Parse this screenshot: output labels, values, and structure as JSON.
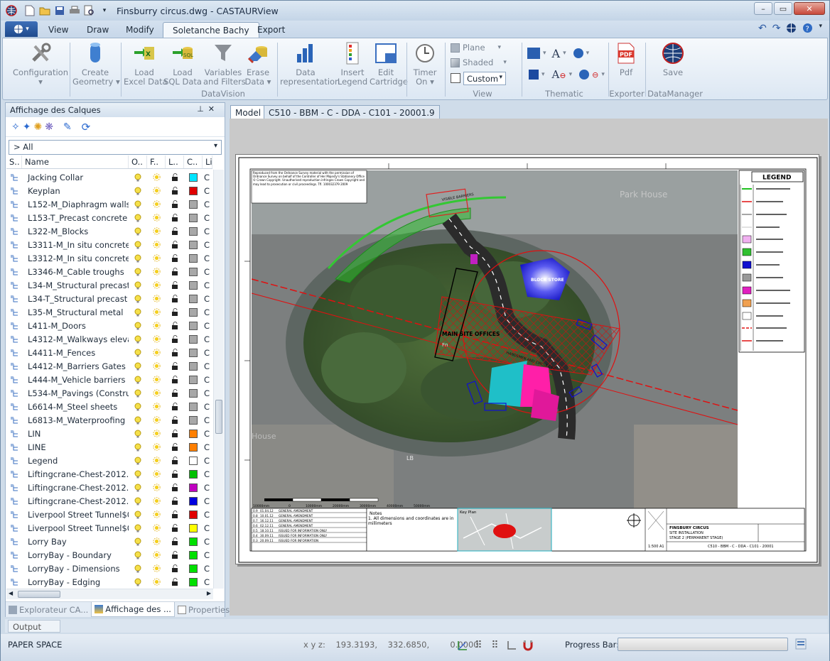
{
  "title": {
    "text": "Finsburry circus.dwg - CASTAURView"
  },
  "qat": {
    "icons": [
      "new-file-icon",
      "open-folder-icon",
      "save-icon",
      "print-icon",
      "print-preview-icon",
      "qat-dropdown-icon"
    ]
  },
  "ribbon_tabs": [
    {
      "label": "View",
      "active": false
    },
    {
      "label": "Draw",
      "active": false
    },
    {
      "label": "Modify",
      "active": false
    },
    {
      "label": "Soletanche Bachy",
      "active": true
    },
    {
      "label": "Export",
      "active": false
    }
  ],
  "ribbon": {
    "buttons": [
      {
        "id": "configuration",
        "label1": "Configuration",
        "label2": "▾",
        "icon": "tools-icon"
      },
      {
        "id": "create_geometry",
        "label1": "Create",
        "label2": "Geometry ▾",
        "icon": "cylinder-icon"
      },
      {
        "id": "load_excel",
        "label1": "Load",
        "label2": "Excel Data",
        "icon": "excel-load-icon"
      },
      {
        "id": "load_sql",
        "label1": "Load",
        "label2": "SQL Data",
        "icon": "sql-load-icon"
      },
      {
        "id": "variables_filters",
        "label1": "Variables",
        "label2": "and Filters",
        "icon": "funnel-icon"
      },
      {
        "id": "erase_data",
        "label1": "Erase",
        "label2": "Data ▾",
        "icon": "eraser-icon"
      },
      {
        "id": "data_representation",
        "label1": "Data",
        "label2": "representation",
        "icon": "bar-chart-icon"
      },
      {
        "id": "insert_legend",
        "label1": "Insert",
        "label2": "Legend",
        "icon": "legend-icon"
      },
      {
        "id": "edit_cartridge",
        "label1": "Edit",
        "label2": "Cartridge",
        "icon": "cartridge-icon"
      },
      {
        "id": "timer_on",
        "label1": "Timer",
        "label2": "On ▾",
        "icon": "clock-icon"
      },
      {
        "id": "pdf",
        "label1": "Pdf",
        "label2": "",
        "icon": "pdf-icon"
      },
      {
        "id": "save",
        "label1": "Save",
        "label2": "",
        "icon": "globe-save-icon"
      }
    ],
    "view_small": {
      "plane": "Plane",
      "shaded": "Shaded",
      "custom": "Custom"
    },
    "groups": {
      "datavision": "DataVision",
      "view": "View",
      "thematic": "Thematic",
      "exporter": "Exporter",
      "datamanager": "DataManager"
    }
  },
  "left_panel": {
    "title": "Affichage des Calques",
    "filter": "> All",
    "columns": [
      "S..",
      "Name",
      "O..",
      "F..",
      "L..",
      "C..",
      "Li"
    ],
    "layers": [
      {
        "name": "Jacking Collar",
        "color": "#00e5ff",
        "lt": "C"
      },
      {
        "name": "Keyplan",
        "color": "#e00000",
        "lt": "C"
      },
      {
        "name": "L152-M_Diaphragm walls an",
        "color": "#a8a8a8",
        "lt": "C"
      },
      {
        "name": "L153-T_Precast concrete ret",
        "color": "#a8a8a8",
        "lt": "C"
      },
      {
        "name": "L322-M_Blocks",
        "color": "#a8a8a8",
        "lt": "C"
      },
      {
        "name": "L3311-M_In situ concrete M",
        "color": "#a8a8a8",
        "lt": "C"
      },
      {
        "name": "L3312-M_In situ concrete Re",
        "color": "#a8a8a8",
        "lt": "C"
      },
      {
        "name": "L3346-M_Cable troughs",
        "color": "#a8a8a8",
        "lt": "C"
      },
      {
        "name": "L34-M_Structural precast co",
        "color": "#a8a8a8",
        "lt": "C"
      },
      {
        "name": "L34-T_Structural precast co",
        "color": "#a8a8a8",
        "lt": "C"
      },
      {
        "name": "L35-M_Structural metal",
        "color": "#a8a8a8",
        "lt": "C"
      },
      {
        "name": "L411-M_Doors",
        "color": "#a8a8a8",
        "lt": "C"
      },
      {
        "name": "L4312-M_Walkways elevate",
        "color": "#a8a8a8",
        "lt": "C"
      },
      {
        "name": "L4411-M_Fences",
        "color": "#a8a8a8",
        "lt": "C"
      },
      {
        "name": "L4412-M_Barriers Gates",
        "color": "#a8a8a8",
        "lt": "C"
      },
      {
        "name": "L444-M_Vehicle barriers",
        "color": "#a8a8a8",
        "lt": "C"
      },
      {
        "name": "L534-M_Pavings (Construct",
        "color": "#a8a8a8",
        "lt": "C"
      },
      {
        "name": "L6614-M_Steel sheets",
        "color": "#a8a8a8",
        "lt": "C"
      },
      {
        "name": "L6813-M_Waterproofing",
        "color": "#a8a8a8",
        "lt": "C"
      },
      {
        "name": "LIN",
        "color": "#ff7f00",
        "lt": "C"
      },
      {
        "name": "LINE",
        "color": "#ff7f00",
        "lt": "C"
      },
      {
        "name": "Legend",
        "color": "#ffffff",
        "lt": "C"
      },
      {
        "name": "Liftingcrane-Chest-2012.01.",
        "color": "#00c000",
        "lt": "C"
      },
      {
        "name": "Liftingcrane-Chest-2012.03.",
        "color": "#c000c0",
        "lt": "C"
      },
      {
        "name": "Liftingcrane-Chest-2012.03.",
        "color": "#0000e0",
        "lt": "C"
      },
      {
        "name": "Liverpool Street Tunnel$0$E",
        "color": "#e00000",
        "lt": "C"
      },
      {
        "name": "Liverpool Street Tunnel$0$I",
        "color": "#ffff00",
        "lt": "C"
      },
      {
        "name": "Lorry Bay",
        "color": "#00e000",
        "lt": "C"
      },
      {
        "name": "LorryBay - Boundary",
        "color": "#00e000",
        "lt": "C"
      },
      {
        "name": "LorryBay - Dimensions",
        "color": "#00e000",
        "lt": "C"
      },
      {
        "name": "LorryBay - Edging",
        "color": "#00e000",
        "lt": "C"
      }
    ],
    "bottom_tabs": [
      {
        "label": "Explorateur CA...",
        "active": false,
        "icon": "explorer-icon"
      },
      {
        "label": "Affichage des ...",
        "active": true,
        "icon": "layers-icon"
      },
      {
        "label": "Properties",
        "active": false,
        "icon": "properties-icon"
      }
    ]
  },
  "doc_tabs": {
    "model": "Model",
    "layout": "C510 - BBM - C - DDA - C101 - 20001.9"
  },
  "drawing": {
    "legend_title": "LEGEND",
    "labels": {
      "main_site_offices": "MAIN SITE OFFICES",
      "block_store": "BLOCK STORE",
      "notes_title": "Notes",
      "note_1": "1. All dimensions and coordinates are in millimeters",
      "keyplan": "Key Plan",
      "project_title": "FINSBURY CIRCUS",
      "project_sub1": "SITE INSTALLATION",
      "project_sub2": "STAGE 2 (PERMANENT STAGE)",
      "doc_number": "C510 - BBM - C - DDA - C101 - 20001",
      "scale": "1:500",
      "paper": "A1",
      "map_text_1": "Park House",
      "map_text_2": "LB",
      "map_text_3": "House",
      "map_text_4": "Fn",
      "copyright": "Reproduced from the Ordnance Survey material with the permission of Ordnance Survey on behalf of the Controller of Her Majesty's Stationery Office © Crown Copyright. Unauthorised reproduction infringes Crown Copyright and may lead to prosecution or civil proceedings. Tfl. 100032379 2009"
    },
    "revisions": [
      {
        "rev": "0.9",
        "date": "01.04.12",
        "desc": "GENERAL AMENDMENT"
      },
      {
        "rev": "0.8",
        "date": "10.01.12",
        "desc": "GENERAL AMENDMENT"
      },
      {
        "rev": "0.7",
        "date": "16.12.11",
        "desc": "GENERAL AMENDMENT"
      },
      {
        "rev": "0.6",
        "date": "02.12.11",
        "desc": "GENERAL AMENDMENT"
      },
      {
        "rev": "0.5",
        "date": "18.10.11",
        "desc": "ISSUED FOR INFORMATION ONLY"
      },
      {
        "rev": "0.4",
        "date": "30.09.11",
        "desc": "ISSUED FOR INFORMATION ONLY"
      },
      {
        "rev": "0.3",
        "date": "20.09.11",
        "desc": "ISSUED FOR INFORMATION"
      }
    ],
    "scalebar": [
      "10000mm",
      "0",
      "10000mm",
      "20000mm",
      "30000mm",
      "40000mm",
      "50000mm"
    ]
  },
  "output_tab": "Output",
  "status": {
    "mode": "PAPER SPACE",
    "xyz": "x y z:    193.3193,    332.6850,        0.0000",
    "progress_label": "Progress Bar:",
    "progress": 0
  }
}
